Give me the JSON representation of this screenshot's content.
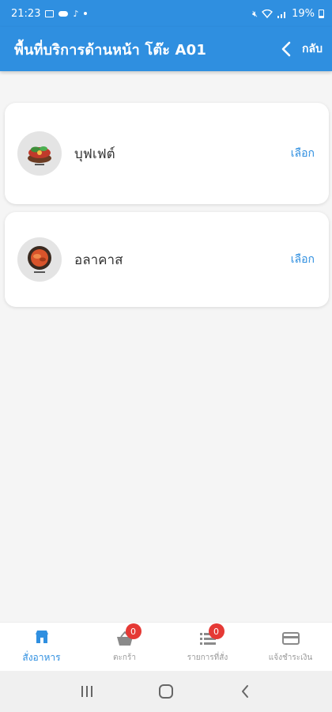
{
  "status_bar": {
    "time": "21:23",
    "battery": "19%"
  },
  "header": {
    "title": "พื้นที่บริการด้านหน้า โต๊ะ A01",
    "back_label": "กลับ"
  },
  "options": [
    {
      "name": "บุฟเฟต์",
      "action": "เลือก",
      "thumb_icon": "buffet-logo-icon"
    },
    {
      "name": "อลาคาส",
      "action": "เลือก",
      "thumb_icon": "alacarte-logo-icon"
    }
  ],
  "bottom_nav": [
    {
      "label": "สั่งอาหาร",
      "icon": "store-icon",
      "active": true
    },
    {
      "label": "ตะกร้า",
      "icon": "basket-icon",
      "badge": "0"
    },
    {
      "label": "รายการที่สั่ง",
      "icon": "list-icon",
      "badge": "0"
    },
    {
      "label": "แจ้งชำระเงิน",
      "icon": "card-icon"
    }
  ],
  "colors": {
    "primary": "#2f8fe0",
    "badge": "#e53935",
    "background": "#f5f5f5"
  }
}
